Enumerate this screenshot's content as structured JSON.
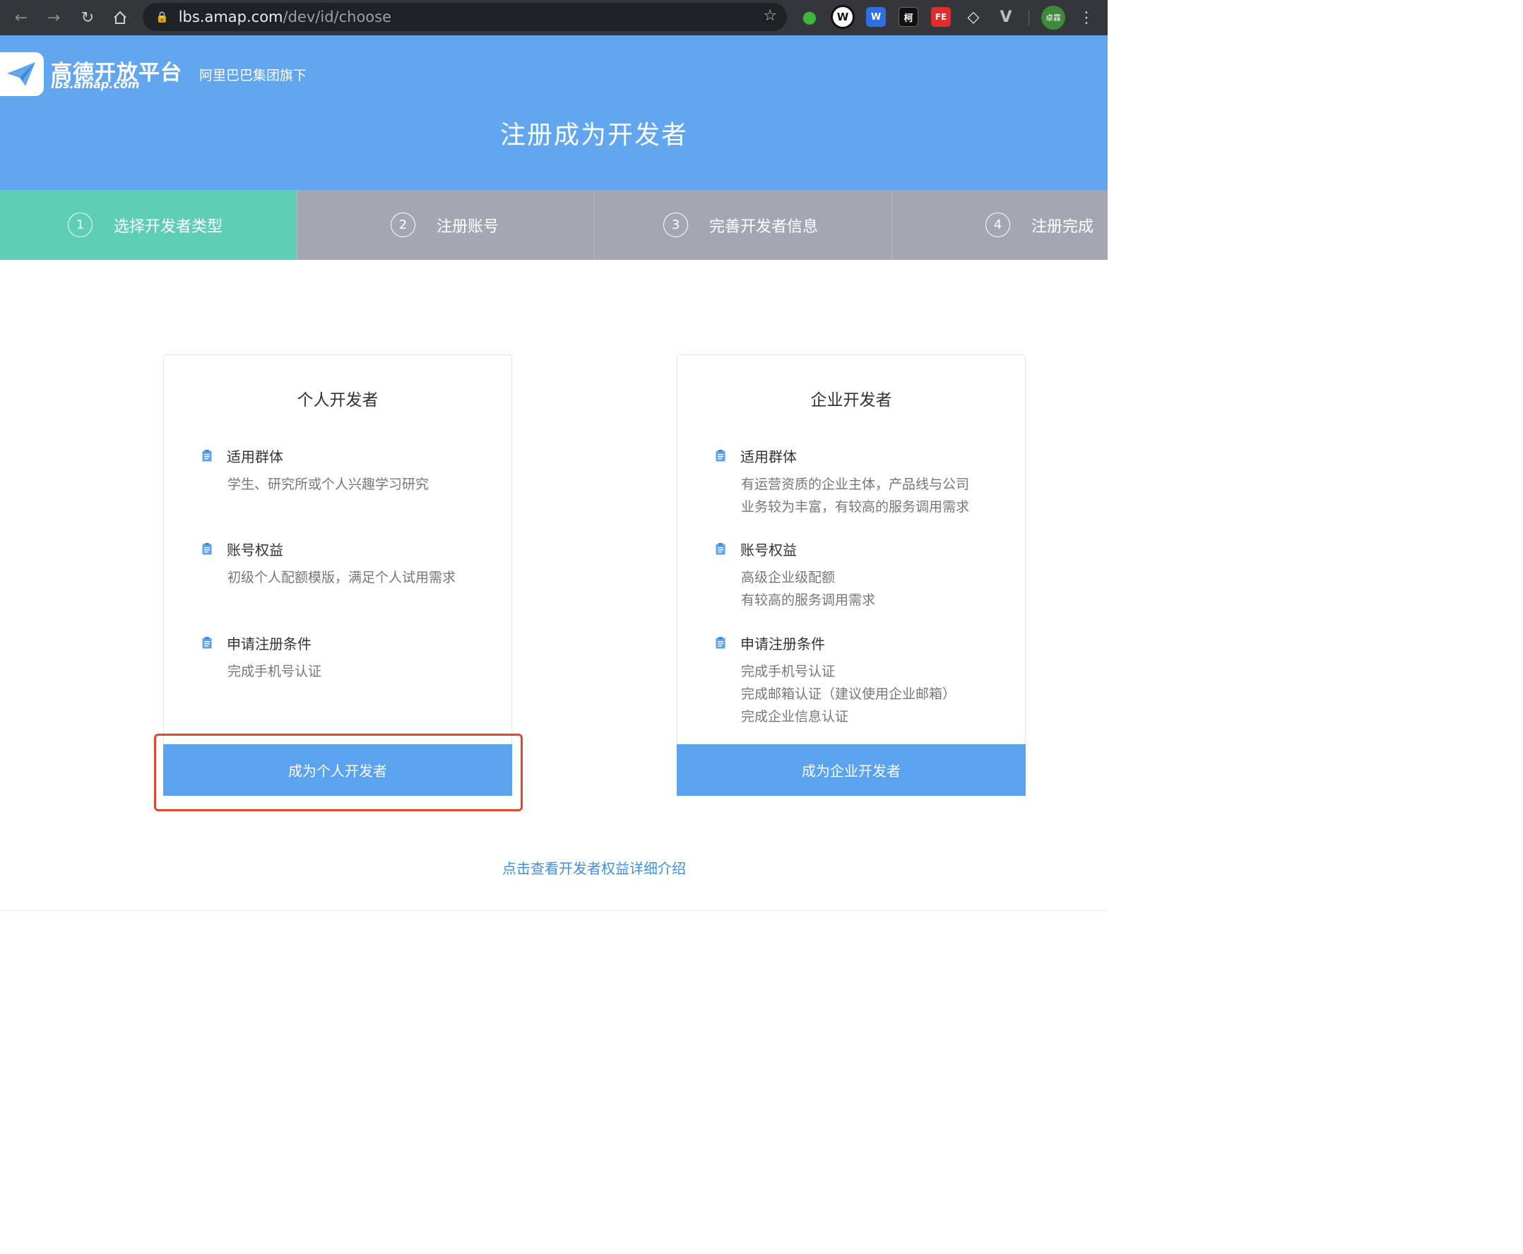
{
  "browser": {
    "url_host": "lbs.amap.com",
    "url_path": "/dev/id/choose",
    "profile_name": "卓霖",
    "extensions": {
      "w": "W",
      "ke": "柯",
      "fe": "FE"
    }
  },
  "header": {
    "logo_text": "高德开放平台",
    "logo_subtext": "lbs.amap.com",
    "group_text": "阿里巴巴集团旗下",
    "title": "注册成为开发者"
  },
  "steps": [
    {
      "num": "1",
      "label": "选择开发者类型"
    },
    {
      "num": "2",
      "label": "注册账号"
    },
    {
      "num": "3",
      "label": "完善开发者信息"
    },
    {
      "num": "4",
      "label": "注册完成"
    }
  ],
  "cards": {
    "personal": {
      "title": "个人开发者",
      "sections": [
        {
          "title": "适用群体",
          "lines": [
            "学生、研究所或个人兴趣学习研究"
          ]
        },
        {
          "title": "账号权益",
          "lines": [
            "初级个人配额模版，满足个人试用需求"
          ]
        },
        {
          "title": "申请注册条件",
          "lines": [
            "完成手机号认证"
          ]
        }
      ],
      "button": "成为个人开发者"
    },
    "enterprise": {
      "title": "企业开发者",
      "sections": [
        {
          "title": "适用群体",
          "lines": [
            "有运营资质的企业主体，产品线与公司",
            "业务较为丰富，有较高的服务调用需求"
          ]
        },
        {
          "title": "账号权益",
          "lines": [
            "高级企业级配额",
            "有较高的服务调用需求"
          ]
        },
        {
          "title": "申请注册条件",
          "lines": [
            "完成手机号认证",
            "完成邮箱认证（建议使用企业邮箱）",
            "完成企业信息认证"
          ]
        }
      ],
      "button": "成为企业开发者"
    }
  },
  "detail_link": "点击查看开发者权益详细介绍",
  "colors": {
    "header_bg": "#62a6ef",
    "step_active": "#5ecfb5",
    "step_inactive": "#a2a7b2",
    "button_bg": "#5ca3ef",
    "highlight": "#e5472a",
    "link": "#3f8fe6"
  },
  "icons": {
    "section_icon": "clipboard-icon",
    "logo_icon": "paper-plane-icon"
  }
}
